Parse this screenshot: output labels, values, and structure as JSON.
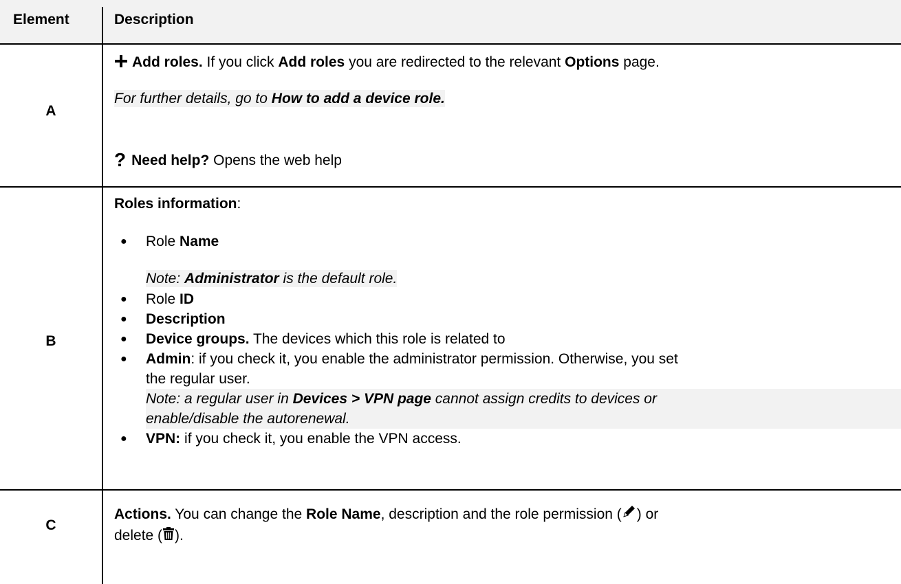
{
  "header": {
    "col_element": "Element",
    "col_description": "Description"
  },
  "row_a": {
    "element": "A",
    "add_roles_bold": "Add roles.",
    "add_roles_text1": " If you click ",
    "add_roles_bold2": "Add roles",
    "add_roles_text2": " you are redirected to the relevant ",
    "add_roles_bold3": "Options",
    "add_roles_text3": " page.",
    "further_prefix": "For further details, go to ",
    "further_link": "How to add a device role.",
    "help_bold": "Need help?",
    "help_text": " Opens the web help"
  },
  "row_b": {
    "element": "B",
    "intro_bold": "Roles information",
    "intro_colon": ":",
    "bullet1_a": "Role ",
    "bullet1_b": "Name",
    "note1_a": "Note: ",
    "note1_b": "Administrator",
    "note1_c": " is the default role.",
    "bullet2_a": "Role ",
    "bullet2_b": "ID",
    "bullet3": "Description",
    "bullet4_b": "Device groups.",
    "bullet4_t": " The devices which this role is related to",
    "bullet5_b": "Admin",
    "bullet5_t1": ": if you check it, you enable the administrator permission. Otherwise, you set",
    "bullet5_t2": "the regular user.",
    "note2_a": "Note: a regular user in ",
    "note2_b": "Devices > VPN page",
    "note2_c": " cannot assign credits to devices or",
    "note2_d": "enable/disable the autorenewal.",
    "bullet6_b": "VPN:",
    "bullet6_t": " if you check it, you enable the VPN access."
  },
  "row_c": {
    "element": "C",
    "actions_b": "Actions.",
    "actions_t1": " You can change the ",
    "actions_b2": "Role Name",
    "actions_t2": ", description and the role permission (",
    "actions_t3": ") or",
    "actions_t4": "delete (",
    "actions_t5": ")."
  },
  "icons": [
    "plus-icon",
    "question-icon",
    "pencil-icon",
    "trash-icon"
  ]
}
